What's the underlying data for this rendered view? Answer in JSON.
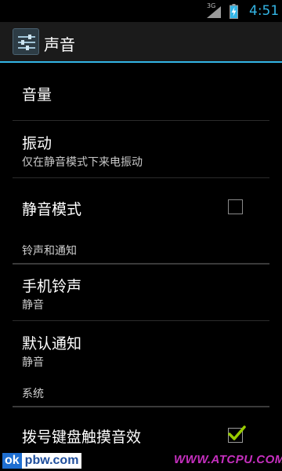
{
  "status_bar": {
    "network_type": "3G",
    "time": "4:51",
    "signal_icon": "signal-strength-icon",
    "battery_icon": "battery-charging-icon"
  },
  "action_bar": {
    "title": "声音",
    "app_icon": "settings-sliders-icon"
  },
  "list": {
    "volume": {
      "title": "音量"
    },
    "vibrate": {
      "title": "振动",
      "summary": "仅在静音模式下来电振动"
    },
    "silent_mode": {
      "title": "静音模式",
      "checked": false
    },
    "ringtone_section": {
      "header": "铃声和通知"
    },
    "phone_ringtone": {
      "title": "手机铃声",
      "summary": "静音"
    },
    "default_notification": {
      "title": "默认通知",
      "summary": "静音"
    },
    "system_section": {
      "header": "系统"
    },
    "dial_pad_touch_tones": {
      "title": "拨号键盘触摸音效",
      "checked": true
    }
  },
  "watermark": {
    "left_brand_ok": "ok",
    "left_brand_rest": "pbw.com",
    "right_text": "WWW.ATCPU.COM"
  },
  "colors": {
    "accent": "#33b5e5",
    "checkmark": "#99cc00",
    "watermark_right": "#c62fbf"
  }
}
